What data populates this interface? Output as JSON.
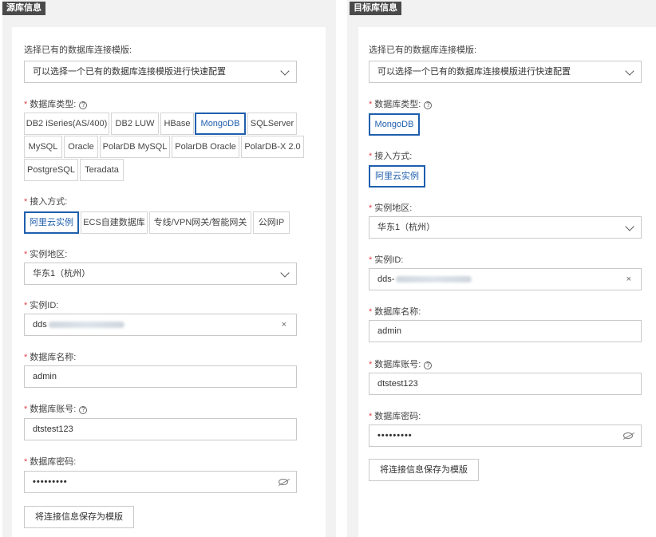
{
  "source": {
    "tag": "源库信息",
    "template_label": "选择已有的数据库连接模版:",
    "template_placeholder": "可以选择一个已有的数据库连接模版进行快速配置",
    "db_type_label": "数据库类型:",
    "db_types": [
      "DB2 iSeries(AS/400)",
      "DB2 LUW",
      "HBase",
      "MongoDB",
      "SQLServer",
      "MySQL",
      "Oracle",
      "PolarDB MySQL",
      "PolarDB Oracle",
      "PolarDB-X 2.0",
      "PostgreSQL",
      "Teradata"
    ],
    "db_type_selected": "MongoDB",
    "access_label": "接入方式:",
    "access_methods": [
      "阿里云实例",
      "ECS自建数据库",
      "专线/VPN网关/智能网关",
      "公网IP"
    ],
    "access_selected": "阿里云实例",
    "region_label": "实例地区:",
    "region_value": "华东1（杭州）",
    "instance_label": "实例ID:",
    "instance_prefix": "dds",
    "dbname_label": "数据库名称:",
    "dbname_value": "admin",
    "account_label": "数据库账号:",
    "account_value": "dtstest123",
    "password_label": "数据库密码:",
    "password_value": "•••••••••",
    "save_button": "将连接信息保存为模版"
  },
  "target": {
    "tag": "目标库信息",
    "template_label": "选择已有的数据库连接模版:",
    "template_placeholder": "可以选择一个已有的数据库连接模版进行快速配置",
    "db_type_label": "数据库类型:",
    "db_type_selected": "MongoDB",
    "access_label": "接入方式:",
    "access_selected": "阿里云实例",
    "region_label": "实例地区:",
    "region_value": "华东1（杭州）",
    "instance_label": "实例ID:",
    "instance_prefix": "dds-",
    "dbname_label": "数据库名称:",
    "dbname_value": "admin",
    "account_label": "数据库账号:",
    "account_value": "dtstest123",
    "password_label": "数据库密码:",
    "password_value": "•••••••••",
    "save_button": "将连接信息保存为模版"
  },
  "icons": {
    "clear": "×",
    "help": "?"
  }
}
